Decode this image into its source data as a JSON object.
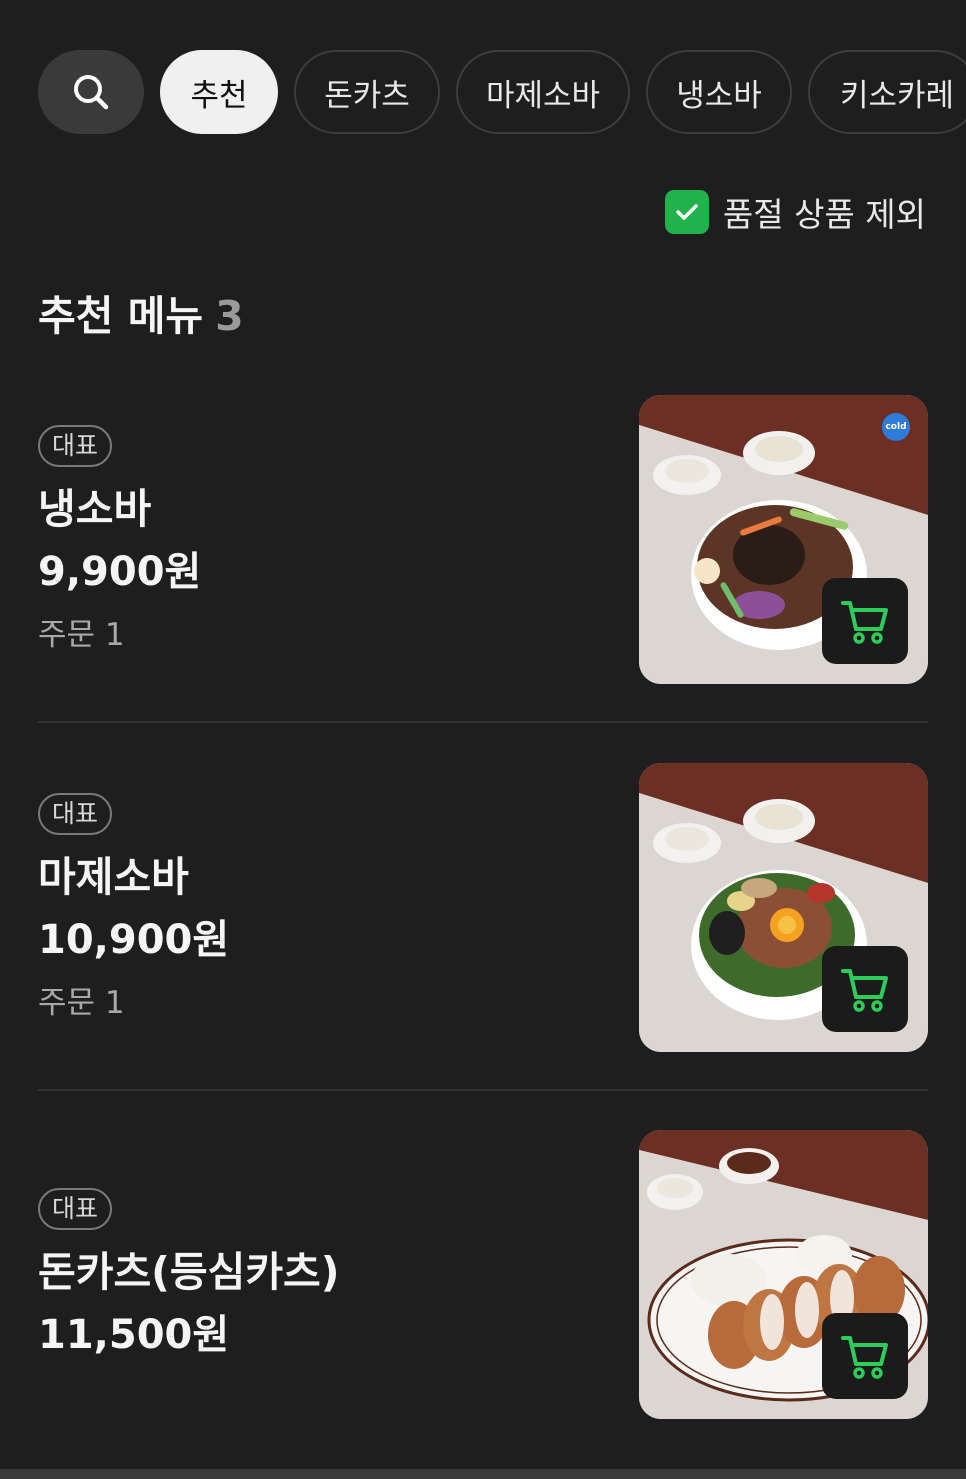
{
  "categories": {
    "search_icon": "search-icon",
    "tabs": [
      {
        "label": "추천",
        "active": true
      },
      {
        "label": "돈카츠",
        "active": false
      },
      {
        "label": "마제소바",
        "active": false
      },
      {
        "label": "냉소바",
        "active": false
      },
      {
        "label": "키소카레",
        "active": false
      }
    ]
  },
  "filter": {
    "exclude_soldout_label": "품절 상품 제외",
    "checked": true
  },
  "section": {
    "title": "추천 메뉴",
    "count": "3"
  },
  "items": [
    {
      "badge": "대표",
      "name": "냉소바",
      "price": "9,900원",
      "orders": "주문 1",
      "cold_label": "cold"
    },
    {
      "badge": "대표",
      "name": "마제소바",
      "price": "10,900원",
      "orders": "주문 1"
    },
    {
      "badge": "대표",
      "name": "돈카츠(등심카츠)",
      "price": "11,500원"
    }
  ],
  "colors": {
    "background": "#1e1e1e",
    "accent_green": "#22b24c",
    "cart_icon_green": "#2ecc5a"
  }
}
